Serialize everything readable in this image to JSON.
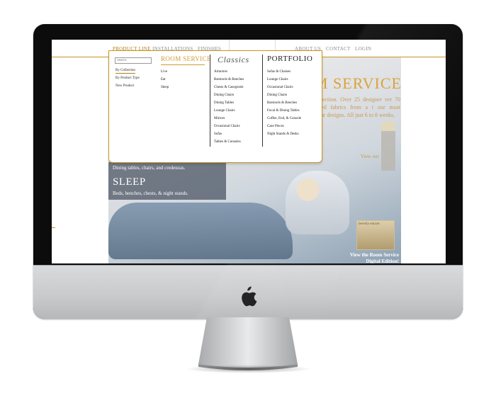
{
  "topnav": {
    "items": [
      "PRODUCT LINE",
      "INSTALLATIONS",
      "FINISHES",
      "ABOUT US",
      "CONTACT",
      "LOGIN"
    ],
    "active": "PRODUCT LINE"
  },
  "hero": {
    "title": "M SERVICE",
    "text": "n collection. Over 25 designer ver 70 selected fabrics from a t our most popular designs. All just 6 to 8 weeks.",
    "text_overlay": "View our",
    "eat_caption": "Dining tables, chairs, and credenzas.",
    "sleep_title": "SLEEP",
    "sleep_caption": "Beds, benches, chests, & night stands.",
    "digital_edition": "View the Room Service Digital Edition!",
    "thumb_label": "beverly encore"
  },
  "mega_menu": {
    "search_placeholder": "Search",
    "filters": [
      "By Collection",
      "By Product Type",
      "New Product"
    ],
    "active_filter": "By Collection",
    "room_service": {
      "title": "ROOM SERVICE",
      "items": [
        "Live",
        "Eat",
        "Sleep"
      ]
    },
    "classics": {
      "title": "Classics",
      "items": [
        "Armoires",
        "Barstools & Benches",
        "Chests & Casegoods",
        "Dining Chairs",
        "Dining Tables",
        "Lounge Chairs",
        "Mirrors",
        "Occasional Chairs",
        "Sofas",
        "Tables & Consoles"
      ]
    },
    "portfolio": {
      "title": "PORTFOLIO",
      "items": [
        "Sofas & Chaises",
        "Lounge Chairs",
        "Occasional Chairs",
        "Dining Chairs",
        "Barstools & Benches",
        "Focal & Dining Tables",
        "Coffee, End, & Console",
        "Case Pieces",
        "Night Stands & Desks"
      ]
    }
  },
  "colors": {
    "accent_gold": "#c8961f",
    "active_nav": "#b07d14",
    "bezel": "#0c0c0c",
    "chin": "#d0d1d3"
  }
}
